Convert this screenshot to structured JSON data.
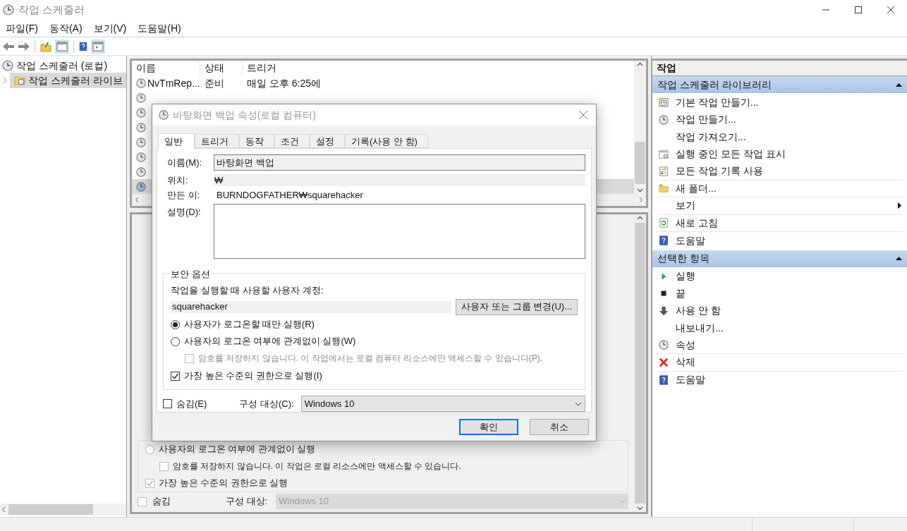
{
  "window": {
    "title": "작업 스케줄러"
  },
  "menu": [
    "파일(F)",
    "동작(A)",
    "보기(V)",
    "도움말(H)"
  ],
  "tree": [
    {
      "label": "작업 스케줄러 (로컬)",
      "selected": false,
      "children": [
        {
          "label": "작업 스케줄러 라이브",
          "selected": true
        }
      ]
    }
  ],
  "task_list": {
    "columns": [
      "이름",
      "상태",
      "트리거"
    ],
    "rows": [
      {
        "name": "NvTmRep...",
        "status": "준비",
        "trigger": "매일 오후 6:25에",
        "selected": false
      },
      {
        "selected": false
      },
      {
        "selected": false
      },
      {
        "selected": false
      },
      {
        "selected": false
      },
      {
        "selected": false
      },
      {
        "selected": false
      },
      {
        "selected": true
      }
    ]
  },
  "detail_pane": {
    "options": [
      {
        "kind": "radio",
        "label": "사용자의 로그온 여부에 관계없이 실행",
        "selected": false
      },
      {
        "kind": "sub_checkbox",
        "label": "암호를 저장하지 않습니다. 이 작업은 로컬 리소스에만 액세스할 수 있습니다.",
        "checked": false
      },
      {
        "kind": "checkbox",
        "label": "가장 높은 수준의 권한으로 실행",
        "checked": true
      }
    ],
    "hidden": {
      "label": "숨김",
      "checked": false
    },
    "configure": {
      "label": "구성 대상:",
      "value": "Windows 10"
    }
  },
  "actions": {
    "title": "작업",
    "sections": [
      {
        "title": "작업 스케줄러 라이브러리",
        "items": [
          {
            "label": "기본 작업 만들기...",
            "kind": "wizard",
            "divider": false,
            "submenu": false
          },
          {
            "label": "작업 만들기...",
            "kind": "clock",
            "divider": false,
            "submenu": false
          },
          {
            "label": "작업 가져오기...",
            "kind": "plain",
            "divider": false,
            "submenu": false
          },
          {
            "label": "실행 중인 모든 작업 표시",
            "kind": "window",
            "divider": false,
            "submenu": false
          },
          {
            "label": "모든 작업 기록 사용",
            "kind": "log",
            "divider": true,
            "submenu": false
          },
          {
            "label": "새 폴더...",
            "kind": "folder",
            "divider": true,
            "submenu": false
          },
          {
            "label": "보기",
            "kind": "plain",
            "divider": true,
            "submenu": true
          },
          {
            "label": "새로 고침",
            "kind": "refresh",
            "divider": true,
            "submenu": false
          },
          {
            "label": "도움말",
            "kind": "help",
            "divider": false,
            "submenu": false
          }
        ]
      },
      {
        "title": "선택한 항목",
        "items": [
          {
            "label": "실행",
            "kind": "play",
            "divider": false,
            "submenu": false
          },
          {
            "label": "끝",
            "kind": "stop",
            "divider": false,
            "submenu": false
          },
          {
            "label": "사용 안 함",
            "kind": "down",
            "divider": false,
            "submenu": false
          },
          {
            "label": "내보내기...",
            "kind": "plain",
            "divider": false,
            "submenu": false
          },
          {
            "label": "속성",
            "kind": "clock",
            "divider": true,
            "submenu": false
          },
          {
            "label": "삭제",
            "kind": "delete",
            "divider": true,
            "submenu": false
          },
          {
            "label": "도움말",
            "kind": "help",
            "divider": false,
            "submenu": false
          }
        ]
      }
    ]
  },
  "dialog": {
    "title": "바탕화면 백업 속성(로컬 컴퓨터)",
    "tabs": [
      {
        "label": "일반",
        "selected": true
      },
      {
        "label": "트리거",
        "selected": false
      },
      {
        "label": "동작",
        "selected": false
      },
      {
        "label": "조건",
        "selected": false
      },
      {
        "label": "설정",
        "selected": false
      },
      {
        "label": "기록(사용 안 함)",
        "selected": false
      }
    ],
    "name_label": "이름(M):",
    "name_value": "바탕화면 백업",
    "location_label": "위치:",
    "location_value": "₩",
    "author_label": "만든 이:",
    "author_value": "BURNDOGFATHER₩squarehacker",
    "description_label": "설명(D):",
    "security": {
      "title": "보안 옵션",
      "account_label": "작업을 실행할 때 사용할 사용자 계정:",
      "account": "squarehacker",
      "change_button": "사용자 또는 그룹 변경(U)...",
      "options": [
        {
          "kind": "radio",
          "label": "사용자가 로그온할 때만 실행(R)",
          "selected": true
        },
        {
          "kind": "radio",
          "label": "사용자의 로그온 여부에 관계없이 실행(W)",
          "selected": false
        },
        {
          "kind": "sub_checkbox",
          "label": "암호를 저장하지 않습니다. 이 작업에서는 로컬 컴퓨터 리소스에만 액세스할 수 있습니다(P).",
          "checked": false
        },
        {
          "kind": "checkbox",
          "label": "가장 높은 수준의 권한으로 실행(I)",
          "checked": true
        }
      ]
    },
    "hidden": {
      "label": "숨김(E)",
      "checked": false
    },
    "configure": {
      "label": "구성 대상(C):",
      "value": "Windows 10"
    },
    "buttons": [
      {
        "label": "확인",
        "default": true
      },
      {
        "label": "취소",
        "default": false
      }
    ]
  }
}
